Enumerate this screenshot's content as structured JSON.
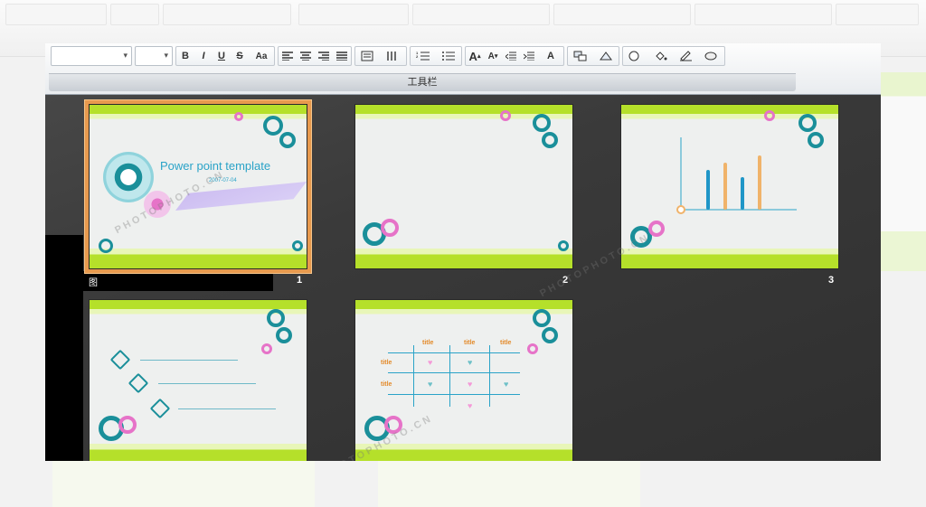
{
  "toolbar": {
    "label": "工具栏",
    "buttons": {
      "bold": "B",
      "italic": "I",
      "underline": "U",
      "strikethrough": "S",
      "change_case": "Aa",
      "font_color": "A"
    }
  },
  "slides": [
    {
      "number": "1",
      "title": "Power point template",
      "date": "2007-07-04"
    },
    {
      "number": "2"
    },
    {
      "number": "3",
      "chart": {
        "type": "bar",
        "values": [
          0.55,
          0.65,
          0.45,
          0.75
        ]
      }
    },
    {
      "number": ""
    },
    {
      "number": "",
      "labels": [
        "title",
        "title",
        "title",
        "title",
        "title"
      ]
    }
  ],
  "black_bar_text": "图",
  "watermark": {
    "brand": "PHOTOPHOTO.CN"
  },
  "colors": {
    "accent_green": "#b5e02a",
    "teal": "#1a8f9a",
    "pink": "#e673c8",
    "orange_selection": "#e89a4e",
    "chart_blue": "#1f96c7",
    "chart_orange": "#f0b36a"
  }
}
